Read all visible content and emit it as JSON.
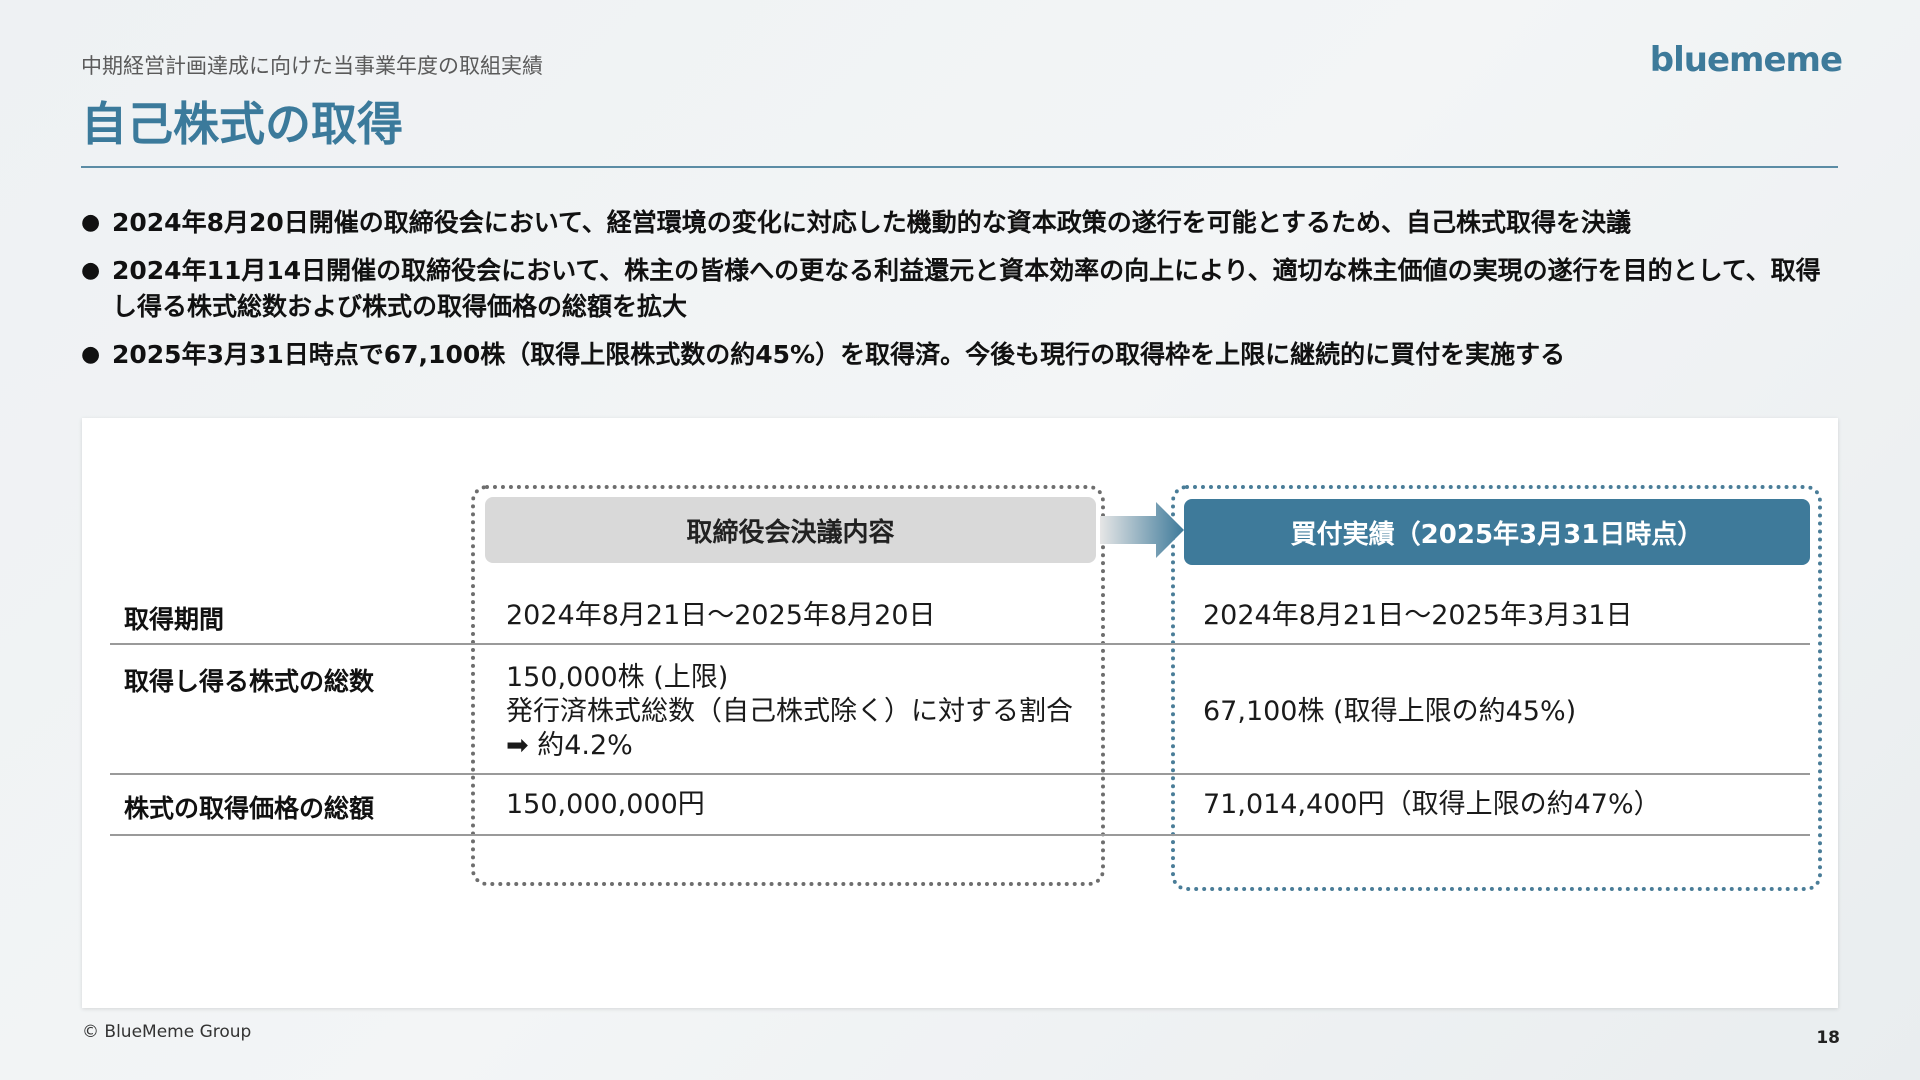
{
  "header": {
    "subtitle": "中期経営計画達成に向けた当事業年度の取組実績",
    "logo": "bluememe",
    "title": "自己株式の取得"
  },
  "bullets": [
    "2024年8月20日開催の取締役会において、経営環境の変化に対応した機動的な資本政策の遂行を可能とするため、自己株式取得を決議",
    "2024年11月14日開催の取締役会において、株主の皆様への更なる利益還元と資本効率の向上により、適切な株主価値の実現の遂行を目的として、取得し得る株式総数および株式の取得価格の総額を拡大",
    "2025年3月31日時点で67,100株（取得上限株式数の約45%）を取得済。今後も現行の取得枠を上限に継続的に買付を実施する"
  ],
  "table": {
    "col_headers": {
      "resolution": "取締役会決議内容",
      "actual": "買付実績（2025年3月31日時点）"
    },
    "rows": [
      {
        "label": "取得期間",
        "resolution": [
          "2024年8月21日～2025年8月20日"
        ],
        "actual": "2024年8月21日～2025年3月31日"
      },
      {
        "label": "取得し得る株式の総数",
        "resolution": [
          "150,000株 (上限)",
          "発行済株式総数（自己株式除く）に対する割合",
          "➡ 約4.2%"
        ],
        "actual": "67,100株 (取得上限の約45%)"
      },
      {
        "label": "株式の取得価格の総額",
        "resolution": [
          "150,000,000円"
        ],
        "actual": "71,014,400円（取得上限の約47%）"
      }
    ]
  },
  "footer": {
    "copyright": "© BlueMeme Group",
    "page": "18"
  },
  "colors": {
    "accent": "#3b7a9b",
    "header_gray": "#d9d9d9"
  }
}
